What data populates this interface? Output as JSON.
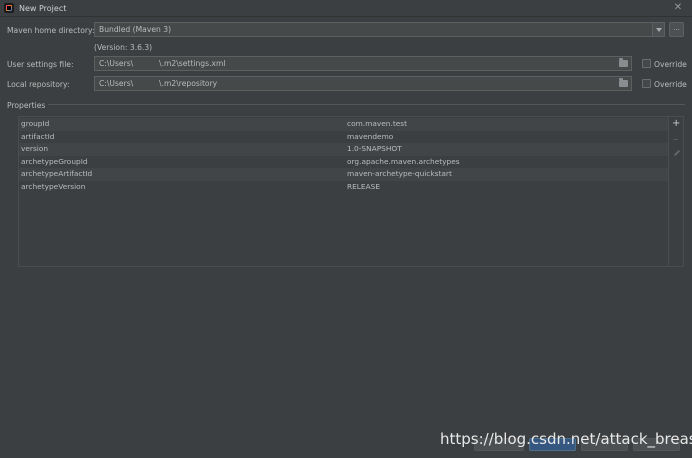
{
  "window": {
    "title": "New Project",
    "app_icon": "intellij-idea-icon",
    "close_icon": "close-icon"
  },
  "form": {
    "maven_home": {
      "label": "Maven home directory:",
      "value": "Bundled (Maven 3)",
      "browse_label": "...",
      "version_text": "(Version: 3.6.3)"
    },
    "user_settings": {
      "label": "User settings file:",
      "value": "C:\\Users\\                 \\.m2\\settings.xml",
      "override_label": "Override"
    },
    "local_repo": {
      "label": "Local repository:",
      "value": "C:\\Users\\                 \\.m2\\repository",
      "override_label": "Override"
    }
  },
  "properties": {
    "section_label": "Properties",
    "rows": [
      {
        "key": "groupId",
        "value": "com.maven.test"
      },
      {
        "key": "artifactId",
        "value": "mavendemo"
      },
      {
        "key": "version",
        "value": "1.0-SNAPSHOT"
      },
      {
        "key": "archetypeGroupId",
        "value": "org.apache.maven.archetypes"
      },
      {
        "key": "archetypeArtifactId",
        "value": "maven-archetype-quickstart"
      },
      {
        "key": "archetypeVersion",
        "value": "RELEASE"
      }
    ],
    "tools": {
      "add_icon": "+",
      "remove_icon": "–"
    }
  },
  "watermark": "https://blog.csdn.net/attack_breast",
  "colors": {
    "background": "#3c3f41",
    "field_bg": "#45494a",
    "primary_button": "#365880",
    "text": "#bbbbbb"
  }
}
